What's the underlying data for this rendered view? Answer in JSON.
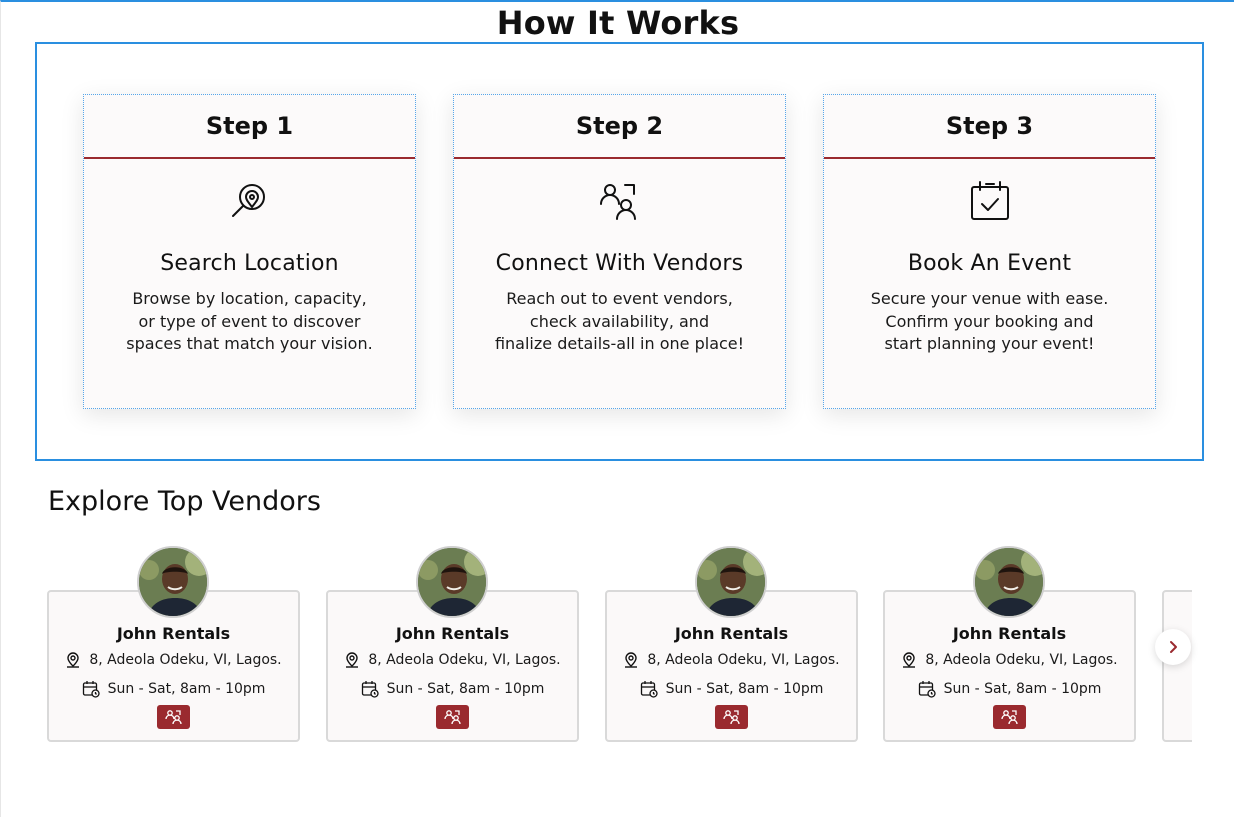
{
  "how_it_works": {
    "title": "How It Works",
    "steps": [
      {
        "step_label": "Step 1",
        "icon": "search-location-icon",
        "title": "Search Location",
        "description_lines": [
          "Browse by location, capacity,",
          "or type of event to discover",
          "spaces that match your vision."
        ]
      },
      {
        "step_label": "Step 2",
        "icon": "people-icon",
        "title": "Connect With Vendors",
        "description_lines": [
          "Reach out to event vendors,",
          "check availability, and",
          "finalize details-all in one place!"
        ]
      },
      {
        "step_label": "Step 3",
        "icon": "calendar-check-icon",
        "title": "Book An Event",
        "description_lines": [
          "Secure your venue with ease.",
          "Confirm your booking and",
          "start planning your event!"
        ]
      }
    ]
  },
  "vendors": {
    "title": "Explore Top Vendors",
    "items": [
      {
        "name": "John Rentals",
        "address": "8, Adeola Odeku, VI, Lagos.",
        "hours": "Sun - Sat, 8am - 10pm"
      },
      {
        "name": "John Rentals",
        "address": "8, Adeola Odeku, VI, Lagos.",
        "hours": "Sun - Sat, 8am - 10pm"
      },
      {
        "name": "John Rentals",
        "address": "8, Adeola Odeku, VI, Lagos.",
        "hours": "Sun - Sat, 8am - 10pm"
      },
      {
        "name": "John Rentals",
        "address": "8, Adeola Odeku, VI, Lagos.",
        "hours": "Sun - Sat, 8am - 10pm"
      }
    ],
    "next_icon": "chevron-right-icon"
  },
  "colors": {
    "accent": "#9a2a2f",
    "frame_blue": "#2a8fe0"
  }
}
